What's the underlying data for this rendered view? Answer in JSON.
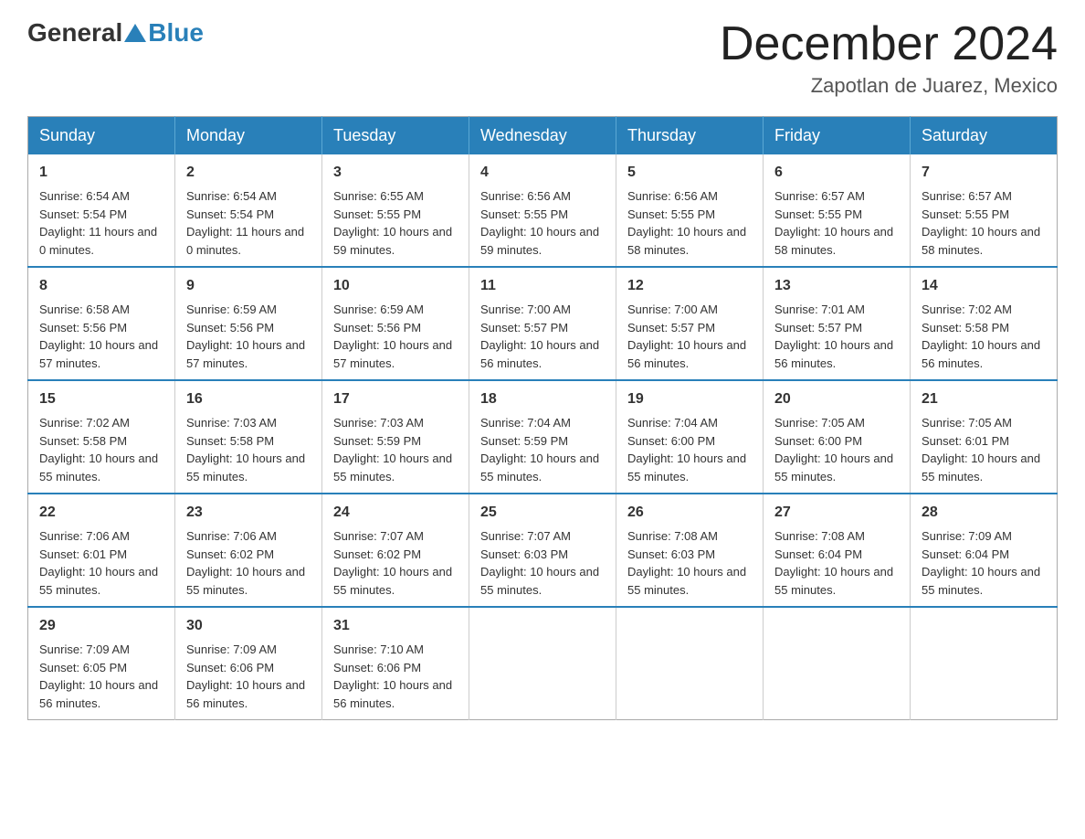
{
  "header": {
    "logo_general": "General",
    "logo_blue": "Blue",
    "month_title": "December 2024",
    "location": "Zapotlan de Juarez, Mexico"
  },
  "weekdays": [
    "Sunday",
    "Monday",
    "Tuesday",
    "Wednesday",
    "Thursday",
    "Friday",
    "Saturday"
  ],
  "weeks": [
    [
      {
        "day": "1",
        "sunrise": "6:54 AM",
        "sunset": "5:54 PM",
        "daylight": "11 hours and 0 minutes."
      },
      {
        "day": "2",
        "sunrise": "6:54 AM",
        "sunset": "5:54 PM",
        "daylight": "11 hours and 0 minutes."
      },
      {
        "day": "3",
        "sunrise": "6:55 AM",
        "sunset": "5:55 PM",
        "daylight": "10 hours and 59 minutes."
      },
      {
        "day": "4",
        "sunrise": "6:56 AM",
        "sunset": "5:55 PM",
        "daylight": "10 hours and 59 minutes."
      },
      {
        "day": "5",
        "sunrise": "6:56 AM",
        "sunset": "5:55 PM",
        "daylight": "10 hours and 58 minutes."
      },
      {
        "day": "6",
        "sunrise": "6:57 AM",
        "sunset": "5:55 PM",
        "daylight": "10 hours and 58 minutes."
      },
      {
        "day": "7",
        "sunrise": "6:57 AM",
        "sunset": "5:55 PM",
        "daylight": "10 hours and 58 minutes."
      }
    ],
    [
      {
        "day": "8",
        "sunrise": "6:58 AM",
        "sunset": "5:56 PM",
        "daylight": "10 hours and 57 minutes."
      },
      {
        "day": "9",
        "sunrise": "6:59 AM",
        "sunset": "5:56 PM",
        "daylight": "10 hours and 57 minutes."
      },
      {
        "day": "10",
        "sunrise": "6:59 AM",
        "sunset": "5:56 PM",
        "daylight": "10 hours and 57 minutes."
      },
      {
        "day": "11",
        "sunrise": "7:00 AM",
        "sunset": "5:57 PM",
        "daylight": "10 hours and 56 minutes."
      },
      {
        "day": "12",
        "sunrise": "7:00 AM",
        "sunset": "5:57 PM",
        "daylight": "10 hours and 56 minutes."
      },
      {
        "day": "13",
        "sunrise": "7:01 AM",
        "sunset": "5:57 PM",
        "daylight": "10 hours and 56 minutes."
      },
      {
        "day": "14",
        "sunrise": "7:02 AM",
        "sunset": "5:58 PM",
        "daylight": "10 hours and 56 minutes."
      }
    ],
    [
      {
        "day": "15",
        "sunrise": "7:02 AM",
        "sunset": "5:58 PM",
        "daylight": "10 hours and 55 minutes."
      },
      {
        "day": "16",
        "sunrise": "7:03 AM",
        "sunset": "5:58 PM",
        "daylight": "10 hours and 55 minutes."
      },
      {
        "day": "17",
        "sunrise": "7:03 AM",
        "sunset": "5:59 PM",
        "daylight": "10 hours and 55 minutes."
      },
      {
        "day": "18",
        "sunrise": "7:04 AM",
        "sunset": "5:59 PM",
        "daylight": "10 hours and 55 minutes."
      },
      {
        "day": "19",
        "sunrise": "7:04 AM",
        "sunset": "6:00 PM",
        "daylight": "10 hours and 55 minutes."
      },
      {
        "day": "20",
        "sunrise": "7:05 AM",
        "sunset": "6:00 PM",
        "daylight": "10 hours and 55 minutes."
      },
      {
        "day": "21",
        "sunrise": "7:05 AM",
        "sunset": "6:01 PM",
        "daylight": "10 hours and 55 minutes."
      }
    ],
    [
      {
        "day": "22",
        "sunrise": "7:06 AM",
        "sunset": "6:01 PM",
        "daylight": "10 hours and 55 minutes."
      },
      {
        "day": "23",
        "sunrise": "7:06 AM",
        "sunset": "6:02 PM",
        "daylight": "10 hours and 55 minutes."
      },
      {
        "day": "24",
        "sunrise": "7:07 AM",
        "sunset": "6:02 PM",
        "daylight": "10 hours and 55 minutes."
      },
      {
        "day": "25",
        "sunrise": "7:07 AM",
        "sunset": "6:03 PM",
        "daylight": "10 hours and 55 minutes."
      },
      {
        "day": "26",
        "sunrise": "7:08 AM",
        "sunset": "6:03 PM",
        "daylight": "10 hours and 55 minutes."
      },
      {
        "day": "27",
        "sunrise": "7:08 AM",
        "sunset": "6:04 PM",
        "daylight": "10 hours and 55 minutes."
      },
      {
        "day": "28",
        "sunrise": "7:09 AM",
        "sunset": "6:04 PM",
        "daylight": "10 hours and 55 minutes."
      }
    ],
    [
      {
        "day": "29",
        "sunrise": "7:09 AM",
        "sunset": "6:05 PM",
        "daylight": "10 hours and 56 minutes."
      },
      {
        "day": "30",
        "sunrise": "7:09 AM",
        "sunset": "6:06 PM",
        "daylight": "10 hours and 56 minutes."
      },
      {
        "day": "31",
        "sunrise": "7:10 AM",
        "sunset": "6:06 PM",
        "daylight": "10 hours and 56 minutes."
      },
      null,
      null,
      null,
      null
    ]
  ]
}
